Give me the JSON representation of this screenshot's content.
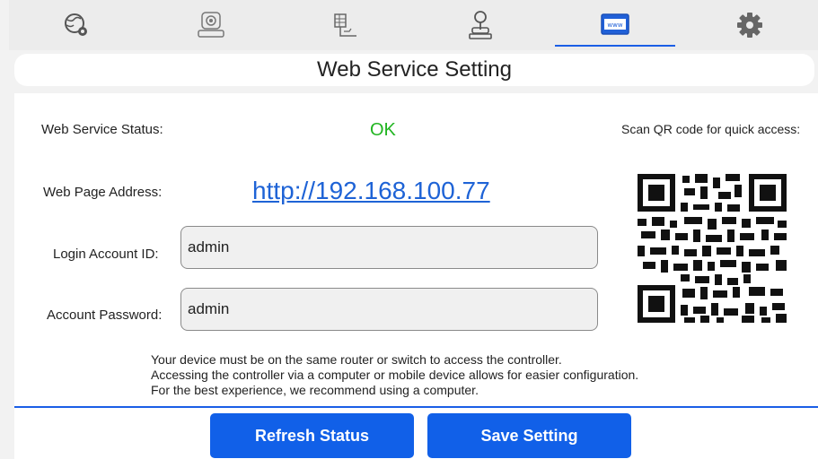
{
  "nav": {
    "tabs": [
      {
        "icon": "network-settings-icon",
        "active": false
      },
      {
        "icon": "ptz-camera-icon",
        "active": false
      },
      {
        "icon": "control-panel-icon",
        "active": false
      },
      {
        "icon": "joystick-icon",
        "active": false
      },
      {
        "icon": "web-service-icon",
        "active": true
      },
      {
        "icon": "gear-icon",
        "active": false
      }
    ]
  },
  "page": {
    "title": "Web Service Setting"
  },
  "web_service": {
    "status_label": "Web Service Status:",
    "status_value": "OK",
    "address_label": "Web Page Address:",
    "address_value": "http://192.168.100.77",
    "login_label": "Login Account ID:",
    "login_value": "admin",
    "password_label": "Account Password:",
    "password_value": "admin",
    "qr_caption": "Scan QR code for quick access:"
  },
  "notice": {
    "lines": [
      "Your device must be on the same router or switch to access the controller.",
      "Accessing the controller via a computer or mobile device allows for easier configuration.",
      "For the best experience, we recommend using a computer."
    ]
  },
  "buttons": {
    "refresh_label": "Refresh Status",
    "save_label": "Save Setting"
  },
  "colors": {
    "accent": "#1160e8",
    "status_ok": "#21b521",
    "link": "#1e63d6"
  }
}
